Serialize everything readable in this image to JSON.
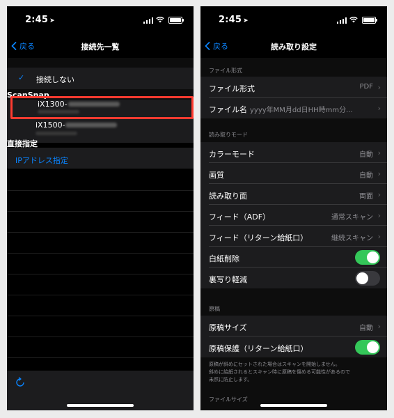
{
  "left": {
    "status_time": "2:45",
    "nav_back": "戻る",
    "nav_title": "接続先一覧",
    "no_connect": "接続しない",
    "scansnap_header": "ScanSnap",
    "devices": [
      {
        "name": "iX1300-"
      },
      {
        "name": "iX1500-"
      }
    ],
    "direct_header": "直接指定",
    "ip_link": "IPアドレス指定"
  },
  "right": {
    "status_time": "2:45",
    "nav_back": "戻る",
    "nav_title": "読み取り設定",
    "sec_filetype": "ファイル形式",
    "file_format_label": "ファイル形式",
    "file_format_value": "PDF",
    "filename_label": "ファイル名",
    "filename_value": "yyyy年MM月dd日HH時mm分...",
    "sec_readmode": "読み取りモード",
    "color_mode_label": "カラーモード",
    "color_mode_value": "自動",
    "quality_label": "画質",
    "quality_value": "自動",
    "side_label": "読み取り面",
    "side_value": "両面",
    "feed_adf_label": "フィード（ADF）",
    "feed_adf_value": "通常スキャン",
    "feed_return_label": "フィード（リターン給紙口）",
    "feed_return_value": "継続スキャン",
    "blank_removal_label": "白紙削除",
    "blank_removal_on": true,
    "bleed_reduction_label": "裏写り軽減",
    "bleed_reduction_on": false,
    "sec_original": "原稿",
    "paper_size_label": "原稿サイズ",
    "paper_size_value": "自動",
    "protect_label": "原稿保護（リターン給紙口）",
    "protect_on": true,
    "footnote_lines": [
      "原稿が斜めにセットされた場合はスキャンを開始しません。",
      "斜めに給紙されるとスキャン時に原稿を傷める可能性があるので",
      "未然に防止します。"
    ],
    "sec_filesize": "ファイルサイズ"
  },
  "colors": {
    "accent": "#0a84ff",
    "highlight": "#ff3b30",
    "toggle_on": "#34c759",
    "cell_bg": "#1c1c1e",
    "secondary_text": "#8e8e93"
  },
  "icons": [
    "location-arrow-icon",
    "signal-icon",
    "wifi-icon",
    "battery-icon",
    "chevron-left-icon",
    "checkmark-icon",
    "chevron-right-icon",
    "refresh-icon"
  ]
}
